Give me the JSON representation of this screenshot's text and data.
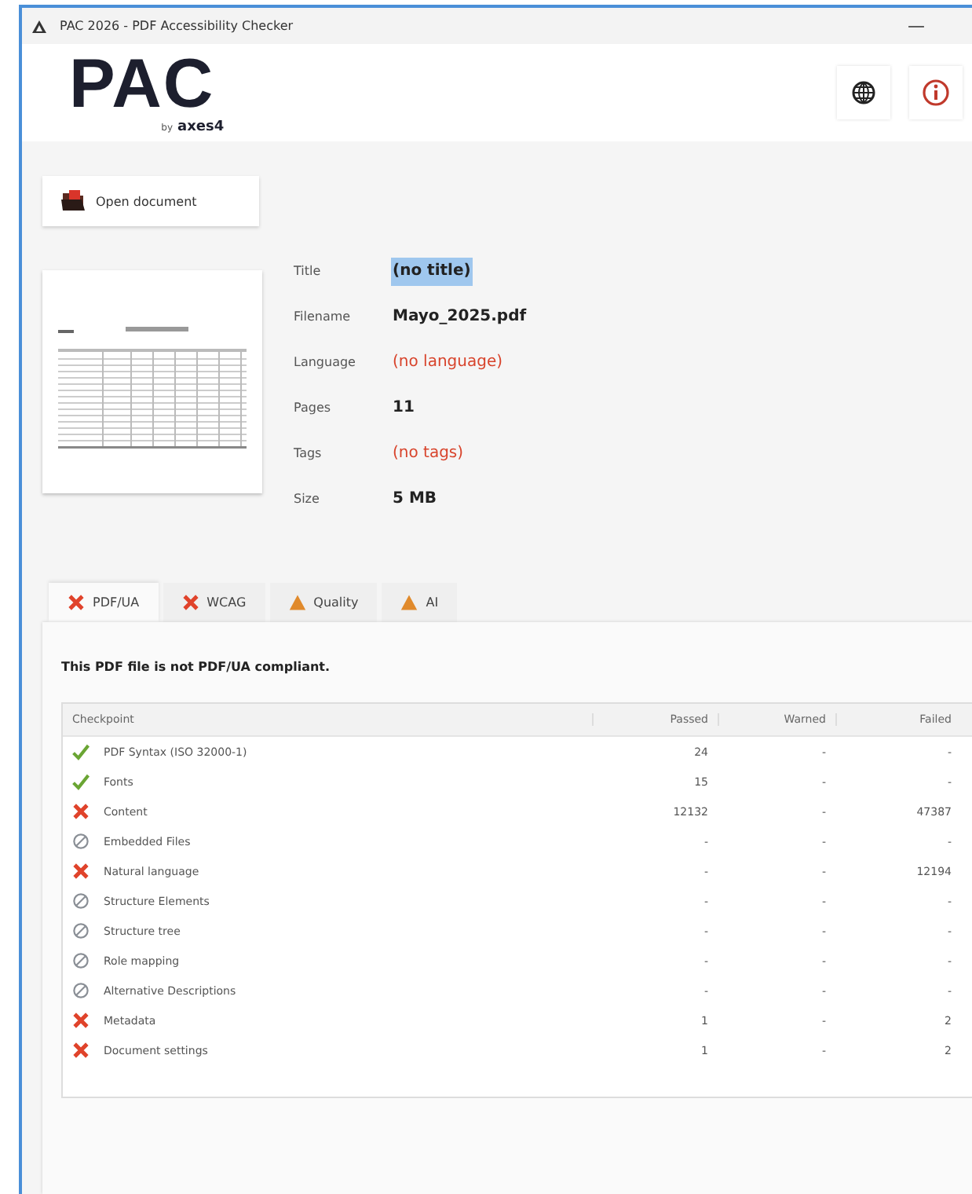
{
  "window": {
    "title": "PAC 2026 - PDF Accessibility Checker",
    "minimize": "—"
  },
  "logo": {
    "name": "PAC",
    "by": "by",
    "brand": "axes4"
  },
  "open_button": {
    "label": "Open document"
  },
  "metadata": [
    {
      "label": "Title",
      "value": "(no title)",
      "missing": false,
      "highlighted": true
    },
    {
      "label": "Filename",
      "value": "Mayo_2025.pdf",
      "missing": false,
      "highlighted": false
    },
    {
      "label": "Language",
      "value": "(no language)",
      "missing": true,
      "highlighted": false
    },
    {
      "label": "Pages",
      "value": "11",
      "missing": false,
      "highlighted": false
    },
    {
      "label": "Tags",
      "value": "(no tags)",
      "missing": true,
      "highlighted": false
    },
    {
      "label": "Size",
      "value": "5 MB",
      "missing": false,
      "highlighted": false
    }
  ],
  "tabs": [
    {
      "label": "PDF/UA",
      "kind": "fail",
      "selected": true
    },
    {
      "label": "WCAG",
      "kind": "fail",
      "selected": false
    },
    {
      "label": "Quality",
      "kind": "warn",
      "selected": false
    },
    {
      "label": "AI",
      "kind": "warn",
      "selected": false
    }
  ],
  "message": "This PDF file is not PDF/UA compliant.",
  "table": {
    "columns": [
      "Checkpoint",
      "Passed",
      "Warned",
      "Failed"
    ],
    "rows": [
      {
        "kind": "pass",
        "name": "PDF Syntax (ISO 32000-1)",
        "passed": "24",
        "warned": "-",
        "failed": "-"
      },
      {
        "kind": "pass",
        "name": "Fonts",
        "passed": "15",
        "warned": "-",
        "failed": "-"
      },
      {
        "kind": "fail",
        "name": "Content",
        "passed": "12132",
        "warned": "-",
        "failed": "47387"
      },
      {
        "kind": "skip",
        "name": "Embedded Files",
        "passed": "-",
        "warned": "-",
        "failed": "-"
      },
      {
        "kind": "fail",
        "name": "Natural language",
        "passed": "-",
        "warned": "-",
        "failed": "12194"
      },
      {
        "kind": "skip",
        "name": "Structure Elements",
        "passed": "-",
        "warned": "-",
        "failed": "-"
      },
      {
        "kind": "skip",
        "name": "Structure tree",
        "passed": "-",
        "warned": "-",
        "failed": "-"
      },
      {
        "kind": "skip",
        "name": "Role mapping",
        "passed": "-",
        "warned": "-",
        "failed": "-"
      },
      {
        "kind": "skip",
        "name": "Alternative Descriptions",
        "passed": "-",
        "warned": "-",
        "failed": "-"
      },
      {
        "kind": "fail",
        "name": "Metadata",
        "passed": "1",
        "warned": "-",
        "failed": "2"
      },
      {
        "kind": "fail",
        "name": "Document settings",
        "passed": "1",
        "warned": "-",
        "failed": "2"
      }
    ]
  }
}
